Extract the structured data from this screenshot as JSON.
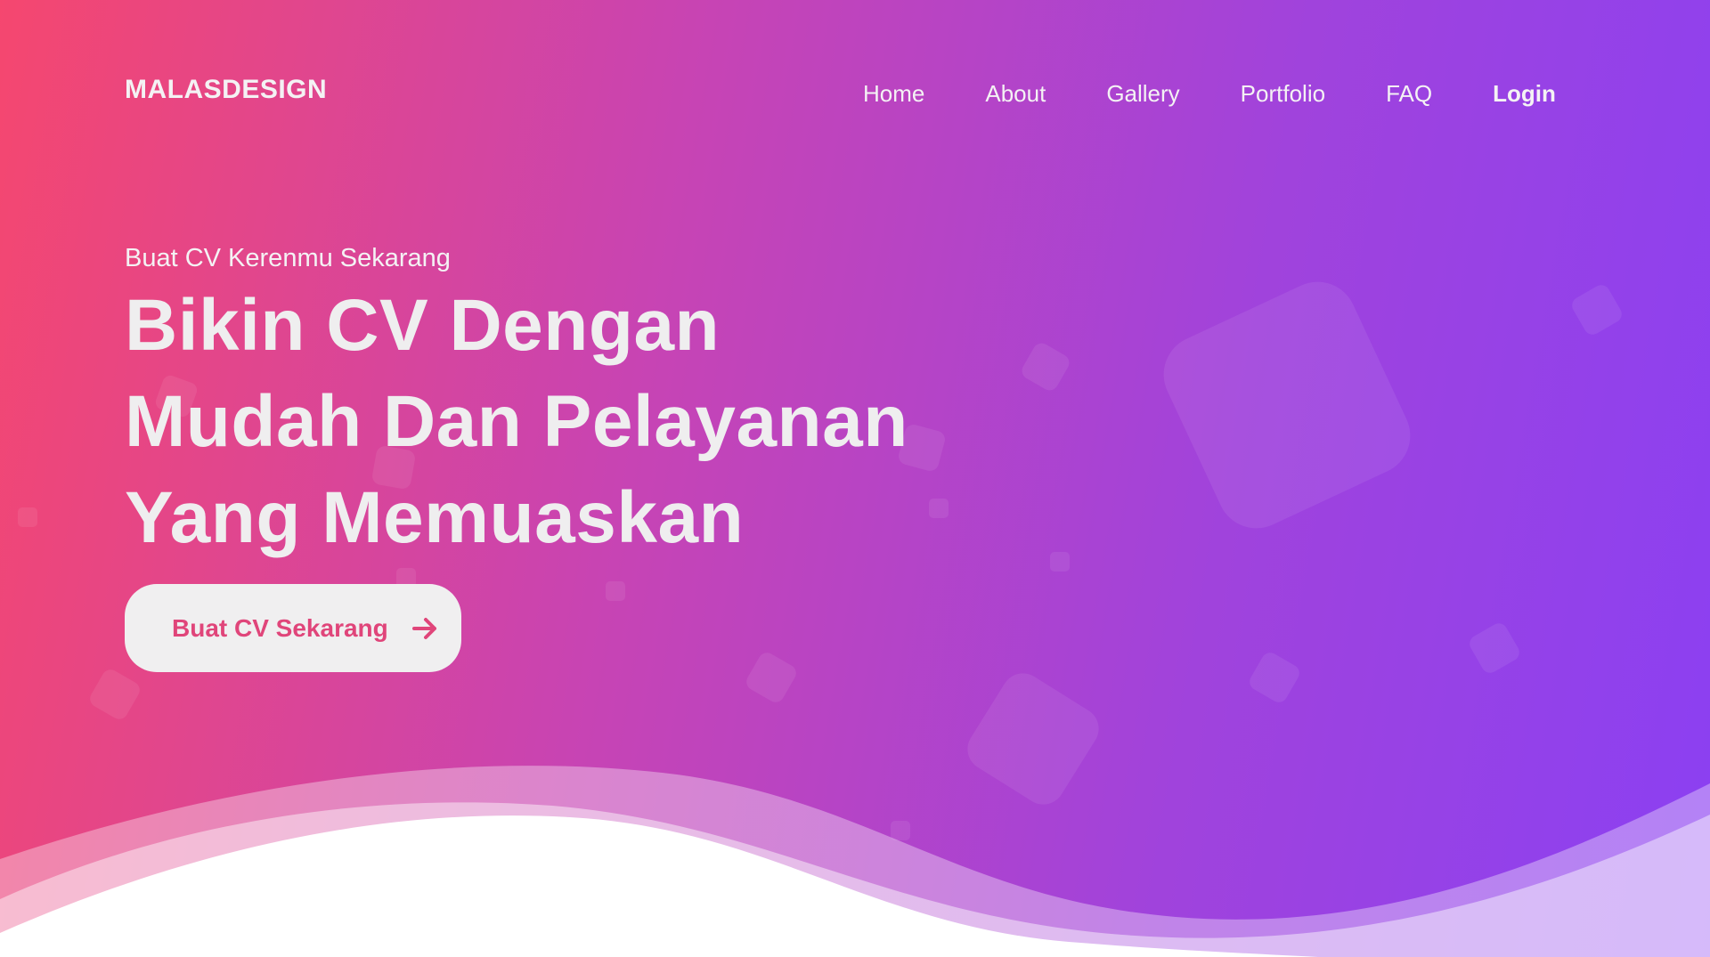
{
  "brand": {
    "logo_text": "MALASDESIGN"
  },
  "nav": {
    "items": [
      {
        "label": "Home"
      },
      {
        "label": "About"
      },
      {
        "label": "Gallery"
      },
      {
        "label": "Portfolio"
      },
      {
        "label": "FAQ"
      },
      {
        "label": "Login"
      }
    ]
  },
  "hero": {
    "eyebrow": "Buat CV Kerenmu Sekarang",
    "headline_lines": [
      "Bikin CV Dengan",
      "Mudah Dan Pelayanan",
      "Yang Memuaskan"
    ],
    "cta_label": "Buat CV Sekarang",
    "cta_icon": "arrow-right-icon"
  },
  "colors": {
    "gradient_start": "#f5476f",
    "gradient_mid": "#c744b4",
    "gradient_end": "#8b40f2",
    "cta_text": "#e0457a",
    "cta_background": "#f0eff0"
  }
}
